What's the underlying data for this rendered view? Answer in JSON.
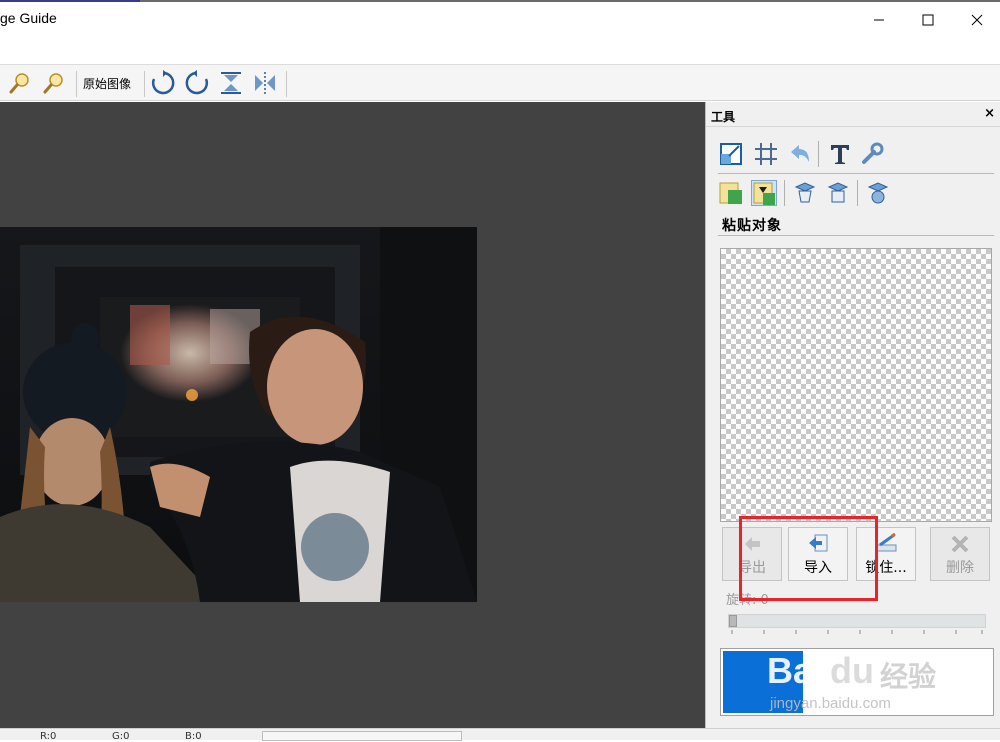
{
  "window": {
    "title": "ge Guide",
    "controls": [
      "minimize",
      "maximize",
      "close"
    ]
  },
  "toolbar": {
    "zoom_in_icon": "zoom-in-icon",
    "zoom_out_icon": "zoom-out-icon",
    "original_label": "原始图像",
    "rotate_cw_icon": "rotate-clockwise-icon",
    "rotate_ccw_icon": "rotate-counterclockwise-icon",
    "flip_v_icon": "flip-vertical-icon",
    "flip_h_icon": "flip-horizontal-icon"
  },
  "panel": {
    "title": "工具",
    "close": "×",
    "section_label": "粘贴对象",
    "buttons": [
      {
        "label": "导出",
        "enabled": false,
        "icon": "export-icon"
      },
      {
        "label": "导入",
        "enabled": true,
        "icon": "import-icon"
      },
      {
        "label": "锁住...",
        "enabled": true,
        "icon": "lock-pen-icon"
      },
      {
        "label": "删除",
        "enabled": false,
        "icon": "delete-icon"
      }
    ],
    "rotate_label": "旋转: 0",
    "rotation_value": 0
  },
  "status": {
    "r": "R:0",
    "g": "G:0",
    "b": "B:0"
  },
  "watermark": {
    "brand": "Bai",
    "brand2": "du",
    "chinese": "经验",
    "url": "jingyan.baidu.com"
  },
  "colors": {
    "canvas": "#424242",
    "highlight": "#e8242a",
    "preview_blue": "#0a6fd6"
  }
}
